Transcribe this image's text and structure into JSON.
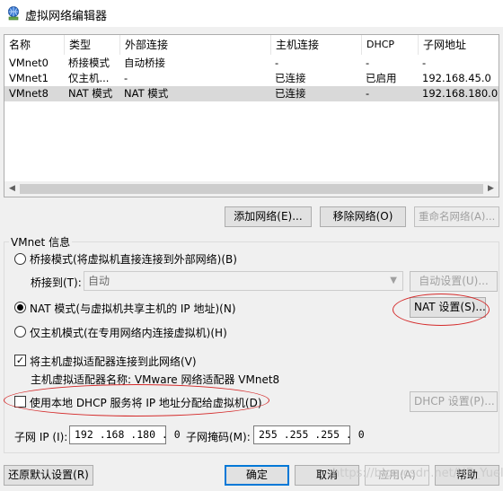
{
  "window": {
    "title": "虚拟网络编辑器",
    "icon": "network-icon"
  },
  "network_list": {
    "columns": [
      "名称",
      "类型",
      "外部连接",
      "主机连接",
      "DHCP",
      "子网地址"
    ],
    "rows": [
      [
        "VMnet0",
        "桥接模式",
        "自动桥接",
        "-",
        "-",
        "-"
      ],
      [
        "VMnet1",
        "仅主机...",
        "-",
        "已连接",
        "已启用",
        "192.168.45.0"
      ],
      [
        "VMnet8",
        "NAT 模式",
        "NAT 模式",
        "已连接",
        "-",
        "192.168.180.0"
      ]
    ],
    "selected_row": 2
  },
  "list_buttons": {
    "add": "添加网络(E)...",
    "remove": "移除网络(O)",
    "rename": "重命名网络(A)..."
  },
  "vmnet_info": {
    "group_label": "VMnet 信息",
    "bridge_mode": "桥接模式(将虚拟机直接连接到外部网络)(B)",
    "bridge_to_label": "桥接到(T):",
    "bridge_to_value": "自动",
    "auto_settings": "自动设置(U)...",
    "nat_mode": "NAT 模式(与虚拟机共享主机的 IP 地址)(N)",
    "nat_settings": "NAT 设置(S)...",
    "host_only": "仅主机模式(在专用网络内连接虚拟机)(H)",
    "connect_adapter": "将主机虚拟适配器连接到此网络(V)",
    "adapter_name": "主机虚拟适配器名称: VMware 网络适配器 VMnet8",
    "use_dhcp": "使用本地 DHCP 服务将 IP 地址分配给虚拟机(D)",
    "dhcp_settings": "DHCP 设置(P)...",
    "subnet_ip_label": "子网 IP (I):",
    "subnet_ip": "192 .168 .180 . 0",
    "subnet_mask_label": "子网掩码(M):",
    "subnet_mask": "255 .255 .255 . 0",
    "selected_mode": "nat",
    "connect_adapter_checked": true,
    "use_dhcp_checked": false
  },
  "footer": {
    "restore_defaults": "还原默认设置(R)",
    "ok": "确定",
    "cancel": "取消",
    "apply": "应用(A)",
    "help": "帮助"
  },
  "watermark": "https://blog.csdn.net/HB_Yuel",
  "annotation_color": "#d42a2a"
}
